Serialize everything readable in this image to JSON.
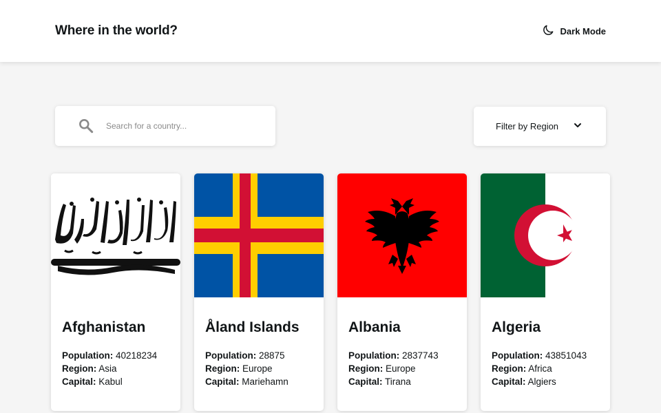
{
  "header": {
    "title": "Where in the world?",
    "theme_toggle_label": "Dark Mode"
  },
  "search": {
    "placeholder": "Search for a country...",
    "value": ""
  },
  "filter": {
    "label": "Filter by Region"
  },
  "labels": {
    "population": "Population:",
    "region": "Region:",
    "capital": "Capital:"
  },
  "countries": [
    {
      "name": "Afghanistan",
      "population": "40218234",
      "region": "Asia",
      "capital": "Kabul"
    },
    {
      "name": "Åland Islands",
      "population": "28875",
      "region": "Europe",
      "capital": "Mariehamn"
    },
    {
      "name": "Albania",
      "population": "2837743",
      "region": "Europe",
      "capital": "Tirana"
    },
    {
      "name": "Algeria",
      "population": "43851043",
      "region": "Africa",
      "capital": "Algiers"
    }
  ],
  "colors": {
    "background": "#f5f5f5",
    "surface": "#ffffff",
    "text": "#111517",
    "aland_blue": "#0053a5",
    "aland_yellow": "#ffce00",
    "aland_red": "#d21034",
    "albania_red": "#ff0000",
    "algeria_green": "#006233",
    "algeria_red": "#d21034"
  }
}
